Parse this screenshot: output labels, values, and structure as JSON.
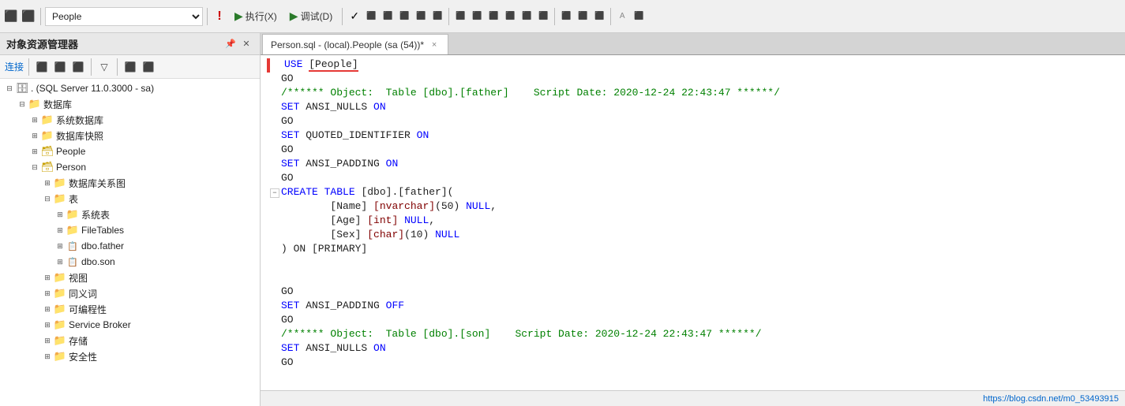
{
  "toolbar": {
    "db_dropdown_value": "People",
    "btn_execute": "执行(X)",
    "btn_debug": "调试(D)",
    "icons": [
      "⬛",
      "⬛",
      "▶",
      "⬛",
      "⬛",
      "⬛",
      "⬛",
      "⬛",
      "⬛",
      "⬛",
      "⬛"
    ]
  },
  "sidebar": {
    "title": "对象资源管理器",
    "connect_label": "连接",
    "tree": [
      {
        "level": 0,
        "toggle": "⊟",
        "icon": "🗄",
        "label": ". (SQL Server 11.0.3000 - sa)",
        "type": "server"
      },
      {
        "level": 1,
        "toggle": "⊟",
        "icon": "📁",
        "label": "数据库",
        "type": "folder"
      },
      {
        "level": 2,
        "toggle": "⊞",
        "icon": "📁",
        "label": "系统数据库",
        "type": "folder"
      },
      {
        "level": 2,
        "toggle": "⊞",
        "icon": "📁",
        "label": "数据库快照",
        "type": "folder"
      },
      {
        "level": 2,
        "toggle": "⊞",
        "icon": "🗃",
        "label": "People",
        "type": "db"
      },
      {
        "level": 2,
        "toggle": "⊟",
        "icon": "🗃",
        "label": "Person",
        "type": "db"
      },
      {
        "level": 3,
        "toggle": "⊞",
        "icon": "📁",
        "label": "数据库关系图",
        "type": "folder"
      },
      {
        "level": 3,
        "toggle": "⊟",
        "icon": "📁",
        "label": "表",
        "type": "folder"
      },
      {
        "level": 4,
        "toggle": "⊞",
        "icon": "📁",
        "label": "系统表",
        "type": "folder"
      },
      {
        "level": 4,
        "toggle": "⊞",
        "icon": "📁",
        "label": "FileTables",
        "type": "folder"
      },
      {
        "level": 4,
        "toggle": "⊞",
        "icon": "📋",
        "label": "dbo.father",
        "type": "table"
      },
      {
        "level": 4,
        "toggle": "⊞",
        "icon": "📋",
        "label": "dbo.son",
        "type": "table"
      },
      {
        "level": 3,
        "toggle": "⊞",
        "icon": "📁",
        "label": "视图",
        "type": "folder"
      },
      {
        "level": 3,
        "toggle": "⊞",
        "icon": "📁",
        "label": "同义词",
        "type": "folder"
      },
      {
        "level": 3,
        "toggle": "⊞",
        "icon": "📁",
        "label": "可编程性",
        "type": "folder"
      },
      {
        "level": 3,
        "toggle": "⊞",
        "icon": "📁",
        "label": "Service Broker",
        "type": "folder"
      },
      {
        "level": 3,
        "toggle": "⊞",
        "icon": "📁",
        "label": "存储",
        "type": "folder"
      },
      {
        "level": 3,
        "toggle": "⊞",
        "icon": "📁",
        "label": "安全性",
        "type": "folder"
      }
    ]
  },
  "editor": {
    "tab_label": "Person.sql - (local).People (sa (54))*",
    "tab_close": "×",
    "code_lines": [
      {
        "id": 1,
        "collapse": "none",
        "content": "USE [People]",
        "type": "use_line"
      },
      {
        "id": 2,
        "collapse": "none",
        "content": "GO",
        "type": "normal"
      },
      {
        "id": 3,
        "collapse": "none",
        "content": "/***** Object:  Table [dbo].[father]    Script Date: 2020-12-24 22:43:47 ******/",
        "type": "comment"
      },
      {
        "id": 4,
        "collapse": "none",
        "content": "SET ANSI_NULLS ON",
        "type": "keyword_line"
      },
      {
        "id": 5,
        "collapse": "none",
        "content": "GO",
        "type": "normal"
      },
      {
        "id": 6,
        "collapse": "none",
        "content": "SET QUOTED_IDENTIFIER ON",
        "type": "keyword_line"
      },
      {
        "id": 7,
        "collapse": "none",
        "content": "GO",
        "type": "normal"
      },
      {
        "id": 8,
        "collapse": "none",
        "content": "SET ANSI_PADDING ON",
        "type": "keyword_line"
      },
      {
        "id": 9,
        "collapse": "none",
        "content": "GO",
        "type": "normal"
      },
      {
        "id": 10,
        "collapse": "minus",
        "content": "CREATE TABLE [dbo].[father](",
        "type": "create_table"
      },
      {
        "id": 11,
        "collapse": "none",
        "content": "    [Name] [nvarchar](50) NULL,",
        "type": "col_def"
      },
      {
        "id": 12,
        "collapse": "none",
        "content": "    [Age] [int] NULL,",
        "type": "col_def"
      },
      {
        "id": 13,
        "collapse": "none",
        "content": "    [Sex] [char](10) NULL",
        "type": "col_def"
      },
      {
        "id": 14,
        "collapse": "none",
        "content": ") ON [PRIMARY]",
        "type": "end_table"
      },
      {
        "id": 15,
        "collapse": "none",
        "content": "",
        "type": "empty"
      },
      {
        "id": 16,
        "collapse": "none",
        "content": "",
        "type": "empty"
      },
      {
        "id": 17,
        "collapse": "none",
        "content": "GO",
        "type": "normal"
      },
      {
        "id": 18,
        "collapse": "none",
        "content": "SET ANSI_PADDING OFF",
        "type": "keyword_line"
      },
      {
        "id": 19,
        "collapse": "none",
        "content": "GO",
        "type": "normal"
      },
      {
        "id": 20,
        "collapse": "none",
        "content": "/***** Object:  Table [dbo].[son]    Script Date: 2020-12-24 22:43:47 ******/",
        "type": "comment"
      },
      {
        "id": 21,
        "collapse": "none",
        "content": "SET ANSI_NULLS ON",
        "type": "keyword_line"
      },
      {
        "id": 22,
        "collapse": "none",
        "content": "GO",
        "type": "normal"
      }
    ]
  },
  "statusbar": {
    "url": "https://blog.csdn.net/m0_53493915"
  }
}
